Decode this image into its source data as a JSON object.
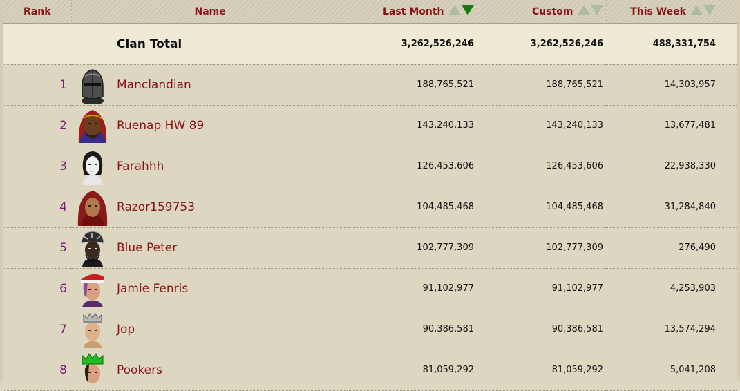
{
  "header": {
    "rank": "Rank",
    "name": "Name",
    "last_month": "Last Month",
    "custom": "Custom",
    "this_week": "This Week"
  },
  "total": {
    "label": "Clan Total",
    "last_month": "3,262,526,246",
    "custom": "3,262,526,246",
    "this_week": "488,331,754"
  },
  "members": [
    {
      "rank": "1",
      "name": "Manclandian",
      "last_month": "188,765,521",
      "custom": "188,765,521",
      "this_week": "14,303,957"
    },
    {
      "rank": "2",
      "name": "Ruenap HW 89",
      "last_month": "143,240,133",
      "custom": "143,240,133",
      "this_week": "13,677,481"
    },
    {
      "rank": "3",
      "name": "Farahhh",
      "last_month": "126,453,606",
      "custom": "126,453,606",
      "this_week": "22,938,330"
    },
    {
      "rank": "4",
      "name": "Razor159753",
      "last_month": "104,485,468",
      "custom": "104,485,468",
      "this_week": "31,284,840"
    },
    {
      "rank": "5",
      "name": "Blue Peter",
      "last_month": "102,777,309",
      "custom": "102,777,309",
      "this_week": "276,490"
    },
    {
      "rank": "6",
      "name": "Jamie Fenris",
      "last_month": "91,102,977",
      "custom": "91,102,977",
      "this_week": "4,253,903"
    },
    {
      "rank": "7",
      "name": "Jop",
      "last_month": "90,386,581",
      "custom": "90,386,581",
      "this_week": "13,574,294"
    },
    {
      "rank": "8",
      "name": "Pookers",
      "last_month": "81,059,292",
      "custom": "81,059,292",
      "this_week": "5,041,208"
    }
  ],
  "colors": {
    "header_text": "#8a1414",
    "rank_text": "#7a1d7a",
    "name_text": "#8a1414",
    "sort_active": "#127a0e",
    "sort_inactive": "#a9bea0",
    "total_row_bg": "#efe9d5",
    "row_bg": "#ddd6c0"
  },
  "icons": {
    "sort_up": "triangle-up",
    "sort_down": "triangle-down",
    "avatars": [
      "steel-helm-avatar",
      "hooded-avatar",
      "pale-avatar",
      "red-hood-avatar",
      "dark-turban-avatar",
      "santa-hat-avatar",
      "crown-avatar",
      "green-crown-avatar"
    ]
  }
}
